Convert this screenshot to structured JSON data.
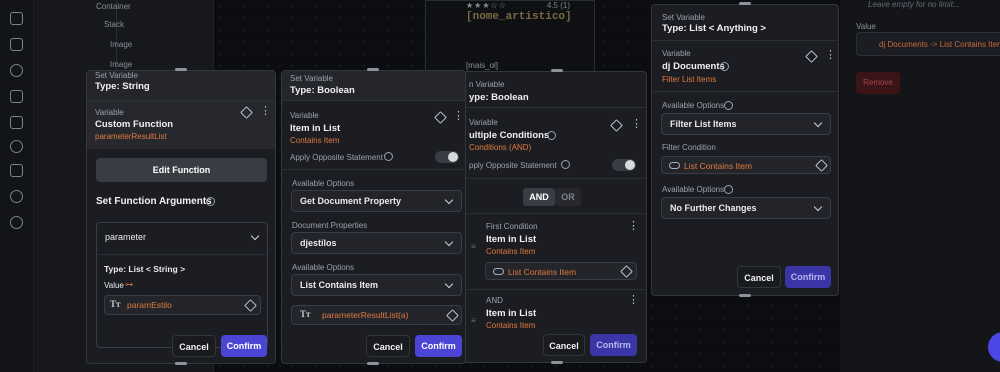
{
  "background": {
    "tree_items": [
      "Container",
      "Stack",
      "Image",
      "Image"
    ],
    "card_title": "[nome_artistico]",
    "card_rating": "4.5 (1)",
    "card_stars": "★★★☆☆",
    "card_tag": "[mais_ol]",
    "right_value_label": "Value",
    "right_value_hint": "Leave empty for no limit...",
    "right_value": "dj Documents -> List Contains Item",
    "right_remove": "Remove"
  },
  "dialog1": {
    "header_label": "Set Variable",
    "header_type": "Type: String",
    "variable_label": "Variable",
    "variable_name": "Custom Function",
    "variable_source": "parameterResultList",
    "edit_function": "Edit Function",
    "args_title": "Set Function Arguments",
    "param_select": "parameter",
    "param_type": "Type: List < String >",
    "value_label": "Value",
    "value_chip": "paramEstilo",
    "cancel": "Cancel",
    "confirm": "Confirm"
  },
  "dialog2": {
    "header_label": "Set Variable",
    "header_type": "Type: Boolean",
    "variable_label": "Variable",
    "variable_name": "Item in List",
    "variable_source": "Contains Item",
    "opposite": "Apply Opposite Statement",
    "avail_label": "Available Options",
    "avail_value": "Get Document Property",
    "doc_props_label": "Document Properties",
    "doc_props_value": "djestilos",
    "avail2_label": "Available Options",
    "avail2_value": "List Contains Item",
    "chip": "parameterResultList(a)",
    "cancel": "Cancel",
    "confirm": "Confirm"
  },
  "dialog3": {
    "header_label": "n Variable",
    "header_type": "ype: Boolean",
    "variable_label": "Variable",
    "variable_name": "ultiple Conditions",
    "variable_source": "Conditions (AND)",
    "opposite": "pply Opposite Statement",
    "seg_and": "AND",
    "seg_or": "OR",
    "cond1_label": "First Condition",
    "cond1_name": "Item in List",
    "cond1_source": "Contains Item",
    "cond1_chip": "List Contains Item",
    "cond2_label": "AND",
    "cond2_name": "Item in List",
    "cond2_source": "Contains Item",
    "cancel": "Cancel",
    "confirm": "Confirm"
  },
  "dialog4": {
    "header_label": "Set Variable",
    "header_type": "Type: List < Anything >",
    "variable_label": "Variable",
    "variable_name": "dj Documents",
    "variable_source": "Filter List Items",
    "avail_label": "Available Options",
    "avail_value": "Filter List Items",
    "filter_label": "Filter Condition",
    "filter_chip": "List Contains Item",
    "avail2_label": "Available Options",
    "avail2_value": "No Further Changes",
    "cancel": "Cancel",
    "confirm": "Confirm"
  }
}
